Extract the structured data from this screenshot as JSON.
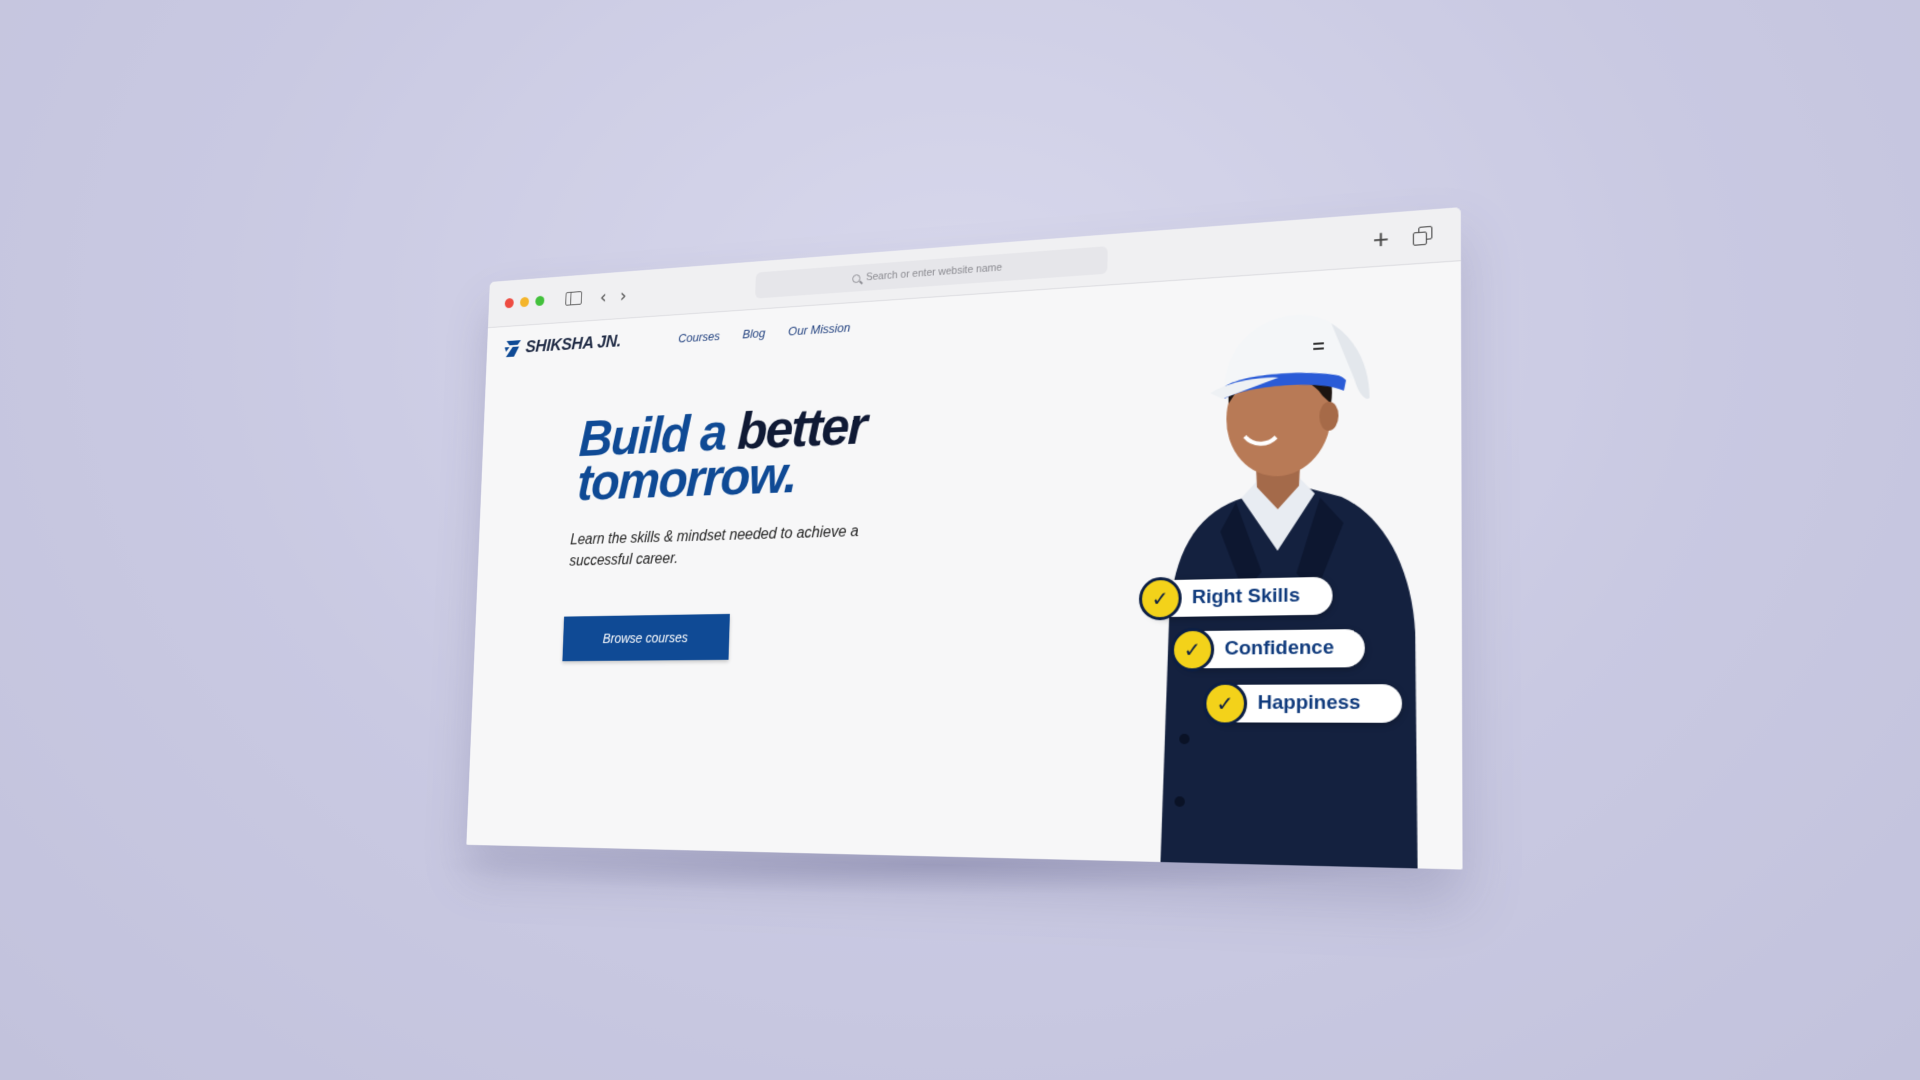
{
  "browser": {
    "address_placeholder": "Search or enter website name",
    "icons": [
      "sidebar-icon",
      "back-arrow-icon",
      "forward-arrow-icon",
      "search-icon",
      "new-tab-plus-icon",
      "tabs-overview-icon"
    ],
    "back_glyph": "‹",
    "forward_glyph": "›",
    "plus_glyph": "+"
  },
  "site": {
    "brand": "SHIKSHA JN.",
    "nav": [
      "Courses",
      "Blog",
      "Our Mission"
    ],
    "hero": {
      "title_part1": "Build a",
      "title_part2": "better",
      "title_part3": "tomorrow.",
      "subtitle": "Learn the skills & mindset needed to achieve a successful career.",
      "cta_label": "Browse courses"
    },
    "benefits": [
      "Right Skills",
      "Confidence",
      "Happiness"
    ],
    "check_glyph": "✓"
  },
  "colors": {
    "brand_blue": "#0f4a95",
    "dark_navy": "#101a35",
    "accent_yellow": "#f3d21a",
    "background": "#c9c9e2"
  }
}
